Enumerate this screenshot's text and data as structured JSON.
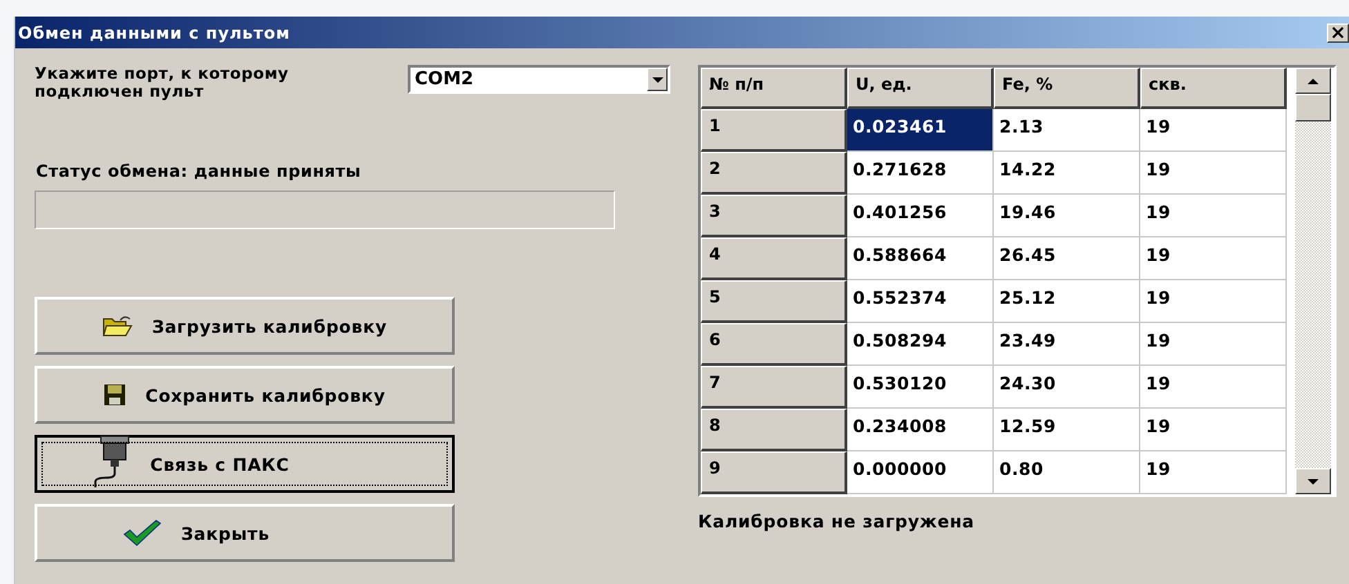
{
  "window": {
    "title": "Обмен данными с пультом",
    "close": "×"
  },
  "port": {
    "label": "Укажите порт, к которому подключен пульт",
    "value": "COM2"
  },
  "status": {
    "label": "Статус обмена: данные приняты"
  },
  "buttons": [
    {
      "label": "Загрузить калибровку",
      "kind": "load",
      "focused": false
    },
    {
      "label": "Сохранить калибровку",
      "kind": "save",
      "focused": false
    },
    {
      "label": "Связь с ПАКС",
      "kind": "connect",
      "focused": true
    },
    {
      "label": "Закрыть",
      "kind": "close",
      "focused": false
    }
  ],
  "table": {
    "columns": [
      "№ п/п",
      "U, ед.",
      "Fe, %",
      "скв."
    ],
    "rows": [
      {
        "cells": [
          {
            "text": "1",
            "selected": false
          },
          {
            "text": "0.023461",
            "selected": true
          },
          {
            "text": "2.13",
            "selected": false
          },
          {
            "text": "19",
            "selected": false
          }
        ]
      },
      {
        "cells": [
          {
            "text": "2",
            "selected": false
          },
          {
            "text": "0.271628",
            "selected": false
          },
          {
            "text": "14.22",
            "selected": false
          },
          {
            "text": "19",
            "selected": false
          }
        ]
      },
      {
        "cells": [
          {
            "text": "3",
            "selected": false
          },
          {
            "text": "0.401256",
            "selected": false
          },
          {
            "text": "19.46",
            "selected": false
          },
          {
            "text": "19",
            "selected": false
          }
        ]
      },
      {
        "cells": [
          {
            "text": "4",
            "selected": false
          },
          {
            "text": "0.588664",
            "selected": false
          },
          {
            "text": "26.45",
            "selected": false
          },
          {
            "text": "19",
            "selected": false
          }
        ]
      },
      {
        "cells": [
          {
            "text": "5",
            "selected": false
          },
          {
            "text": "0.552374",
            "selected": false
          },
          {
            "text": "25.12",
            "selected": false
          },
          {
            "text": "19",
            "selected": false
          }
        ]
      },
      {
        "cells": [
          {
            "text": "6",
            "selected": false
          },
          {
            "text": "0.508294",
            "selected": false
          },
          {
            "text": "23.49",
            "selected": false
          },
          {
            "text": "19",
            "selected": false
          }
        ]
      },
      {
        "cells": [
          {
            "text": "7",
            "selected": false
          },
          {
            "text": "0.530120",
            "selected": false
          },
          {
            "text": "24.30",
            "selected": false
          },
          {
            "text": "19",
            "selected": false
          }
        ]
      },
      {
        "cells": [
          {
            "text": "8",
            "selected": false
          },
          {
            "text": "0.234008",
            "selected": false
          },
          {
            "text": "12.59",
            "selected": false
          },
          {
            "text": "19",
            "selected": false
          }
        ]
      },
      {
        "cells": [
          {
            "text": "9",
            "selected": false
          },
          {
            "text": "0.000000",
            "selected": false
          },
          {
            "text": "0.80",
            "selected": false
          },
          {
            "text": "19",
            "selected": false
          }
        ]
      }
    ]
  },
  "calibration_status": "Калибровка не загружена"
}
